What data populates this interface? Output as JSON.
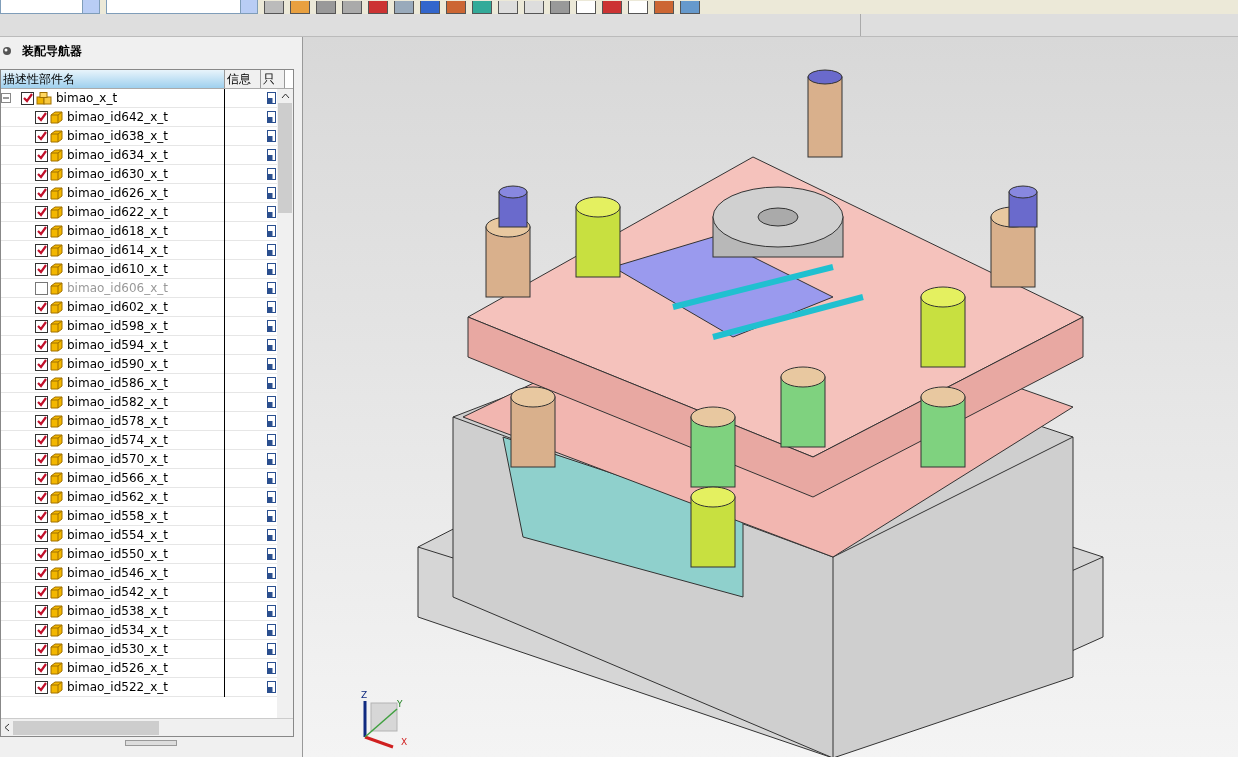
{
  "navigator": {
    "title": "装配导航器",
    "columns": [
      "描述性部件名",
      "信息",
      "只"
    ],
    "tree": [
      {
        "label": "bimao_x_t",
        "checked": true,
        "expanded": true,
        "children": [
          {
            "label": "bimao_id642_x_t",
            "checked": true
          },
          {
            "label": "bimao_id638_x_t",
            "checked": true
          },
          {
            "label": "bimao_id634_x_t",
            "checked": true
          },
          {
            "label": "bimao_id630_x_t",
            "checked": true
          },
          {
            "label": "bimao_id626_x_t",
            "checked": true
          },
          {
            "label": "bimao_id622_x_t",
            "checked": true
          },
          {
            "label": "bimao_id618_x_t",
            "checked": true
          },
          {
            "label": "bimao_id614_x_t",
            "checked": true
          },
          {
            "label": "bimao_id610_x_t",
            "checked": true
          },
          {
            "label": "bimao_id606_x_t",
            "checked": false
          },
          {
            "label": "bimao_id602_x_t",
            "checked": true
          },
          {
            "label": "bimao_id598_x_t",
            "checked": true
          },
          {
            "label": "bimao_id594_x_t",
            "checked": true
          },
          {
            "label": "bimao_id590_x_t",
            "checked": true
          },
          {
            "label": "bimao_id586_x_t",
            "checked": true
          },
          {
            "label": "bimao_id582_x_t",
            "checked": true
          },
          {
            "label": "bimao_id578_x_t",
            "checked": true
          },
          {
            "label": "bimao_id574_x_t",
            "checked": true
          },
          {
            "label": "bimao_id570_x_t",
            "checked": true
          },
          {
            "label": "bimao_id566_x_t",
            "checked": true
          },
          {
            "label": "bimao_id562_x_t",
            "checked": true
          },
          {
            "label": "bimao_id558_x_t",
            "checked": true
          },
          {
            "label": "bimao_id554_x_t",
            "checked": true
          },
          {
            "label": "bimao_id550_x_t",
            "checked": true
          },
          {
            "label": "bimao_id546_x_t",
            "checked": true
          },
          {
            "label": "bimao_id542_x_t",
            "checked": true
          },
          {
            "label": "bimao_id538_x_t",
            "checked": true
          },
          {
            "label": "bimao_id534_x_t",
            "checked": true
          },
          {
            "label": "bimao_id530_x_t",
            "checked": true
          },
          {
            "label": "bimao_id526_x_t",
            "checked": true
          },
          {
            "label": "bimao_id522_x_t",
            "checked": true
          }
        ]
      }
    ]
  },
  "viewport": {
    "axes": [
      "Z",
      "Y",
      "X"
    ]
  }
}
